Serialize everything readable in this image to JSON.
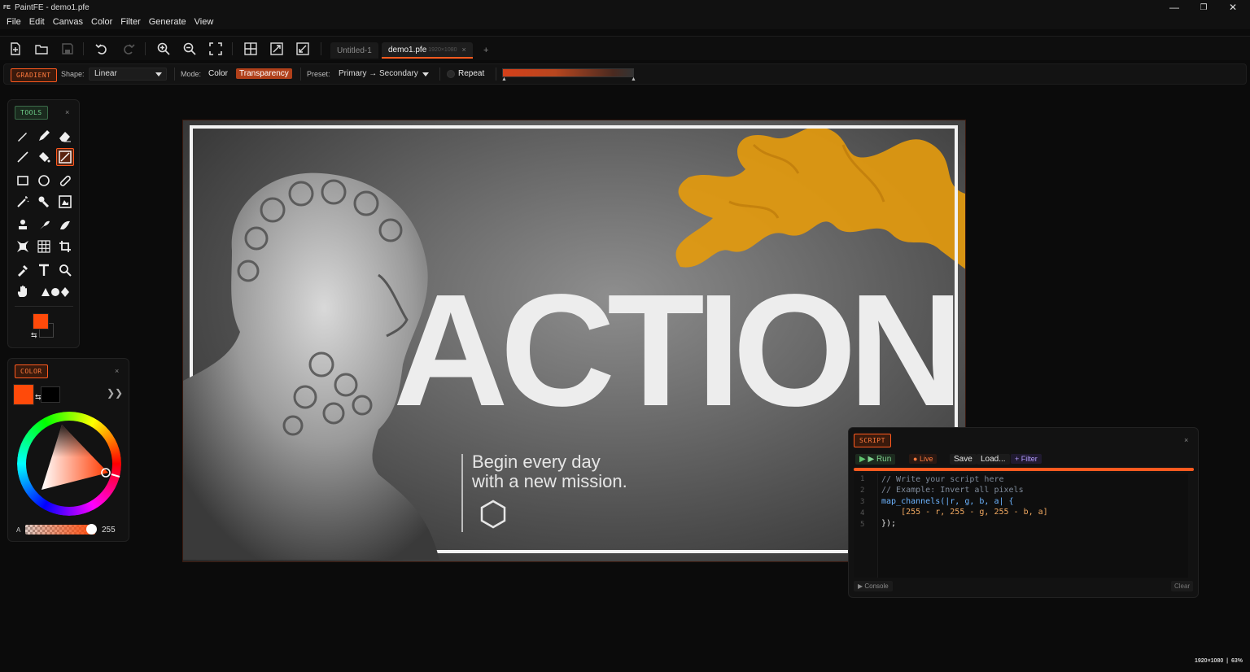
{
  "app": {
    "logo": "FE",
    "title": "PaintFE - demo1.pfe",
    "window_controls": [
      "—",
      "❐",
      "✕"
    ]
  },
  "menu": [
    "File",
    "Edit",
    "Canvas",
    "Color",
    "Filter",
    "Generate",
    "View"
  ],
  "toolbar": {
    "icons": [
      "new-file-icon",
      "open-folder-icon",
      "save-icon",
      "undo-icon",
      "redo-icon",
      "zoom-in-icon",
      "zoom-out-icon",
      "fit-screen-icon",
      "grid-icon",
      "resize-image-icon",
      "resize-canvas-icon"
    ],
    "tabs": [
      {
        "label": "Untitled-1",
        "dims": "",
        "active": false
      },
      {
        "label": "demo1.pfe",
        "dims": "1920×1080",
        "active": true,
        "close": "×"
      }
    ],
    "add_tab": "+"
  },
  "options": {
    "tool_badge": "GRADIENT",
    "shape_label": "Shape:",
    "shape_value": "Linear",
    "mode_label": "Mode:",
    "mode_color": "Color",
    "mode_transparency": "Transparency",
    "preset_label": "Preset:",
    "preset_value": "Primary → Secondary",
    "repeat_label": "Repeat",
    "gradient_from": "#c9401a",
    "gradient_to": "#3a3a3a"
  },
  "canvas": {
    "headline": "ACTION",
    "tagline_line1": "Begin every day",
    "tagline_line2": "with a new mission.",
    "accent_color": "#f0a010"
  },
  "tools_panel": {
    "title": "TOOLS",
    "close": "×",
    "tools": [
      [
        "brush-icon",
        "pencil-icon",
        "eraser-icon"
      ],
      [
        "line-icon",
        "fill-bucket-icon",
        "gradient-icon"
      ],
      [
        "rectangle-icon",
        "ellipse-icon",
        "bandage-icon"
      ],
      [
        "magic-wand-icon",
        "clone-icon",
        "content-fill-icon"
      ],
      [
        "stamp-icon",
        "smudge-icon",
        "liquify-icon"
      ],
      [
        "perspective-icon",
        "mesh-icon",
        "crop-icon"
      ],
      [
        "eyedropper-icon",
        "text-icon",
        "magnifier-icon"
      ],
      [
        "hand-icon",
        "shapes-icon"
      ]
    ],
    "active_tool": "gradient-icon",
    "primary_color": "#ff4a0a",
    "secondary_color": "#111111"
  },
  "color_panel": {
    "title": "COLOR",
    "close": "×",
    "expand": "❯❯",
    "primary_color": "#ff4a0a",
    "secondary_color": "#000000",
    "alpha_label": "A",
    "alpha_value": "255"
  },
  "script_panel": {
    "title": "SCRIPT",
    "close": "×",
    "run": "▶ Run",
    "live": "Live",
    "save": "Save",
    "load": "Load...",
    "filter": "+ Filter",
    "lines": [
      "// Write your script here",
      "// Example: Invert all pixels",
      "map_channels(|r, g, b, a| {",
      "    [255 - r, 255 - g, 255 - b, a]",
      "});"
    ],
    "line_numbers": [
      "1",
      "2",
      "3",
      "4",
      "5"
    ],
    "console": "Console",
    "clear": "Clear"
  },
  "status": {
    "text": "1920×1080  |  63%"
  }
}
